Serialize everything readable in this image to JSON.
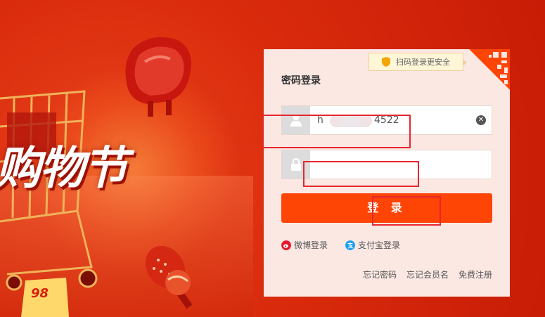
{
  "promo": {
    "title": "购物节",
    "badge_text": "98"
  },
  "login": {
    "qr_tip": "扫码登录更安全",
    "title": "密码登录",
    "username": {
      "value_start": "h",
      "value_end": "4522",
      "icon": "user-icon"
    },
    "password": {
      "value": "",
      "icon": "lock-icon"
    },
    "submit_label": "登 录",
    "social": [
      {
        "label": "微博登录",
        "icon": "weibo-icon",
        "color": "#e6162d"
      },
      {
        "label": "支付宝登录",
        "icon": "alipay-icon",
        "color": "#1a9ff0"
      }
    ],
    "links": [
      "忘记密码",
      "忘记会员名",
      "免费注册"
    ]
  },
  "colors": {
    "background": "#d92a0c",
    "button": "#ff4506",
    "card": "#fbe8e3",
    "annotation": "#e8262f"
  }
}
